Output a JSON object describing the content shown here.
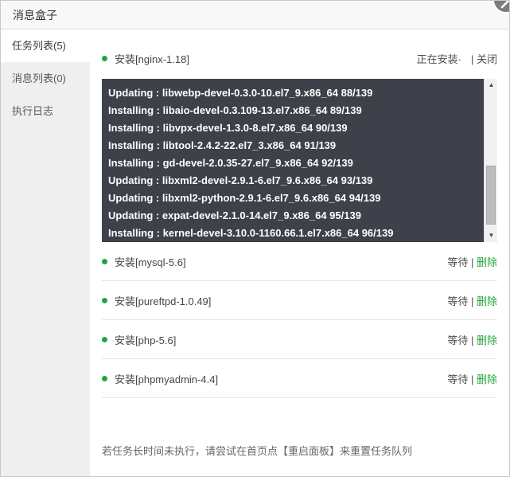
{
  "window": {
    "title": "消息盒子"
  },
  "sidebar": {
    "items": [
      {
        "label": "任务列表(5)"
      },
      {
        "label": "消息列表(0)"
      },
      {
        "label": "执行日志"
      }
    ]
  },
  "ui": {
    "pipe": "|"
  },
  "tasks": {
    "installing": {
      "name": "安装[nginx-1.18]",
      "status": "正在安装·",
      "close_label": "关闭"
    },
    "waiting": [
      {
        "name": "安装[mysql-5.6]",
        "status": "等待",
        "delete_label": "删除"
      },
      {
        "name": "安装[pureftpd-1.0.49]",
        "status": "等待",
        "delete_label": "删除"
      },
      {
        "name": "安装[php-5.6]",
        "status": "等待",
        "delete_label": "删除"
      },
      {
        "name": "安装[phpmyadmin-4.4]",
        "status": "等待",
        "delete_label": "删除"
      }
    ]
  },
  "console": {
    "lines": [
      "Updating : libwebp-devel-0.3.0-10.el7_9.x86_64 88/139",
      "Installing : libaio-devel-0.3.109-13.el7.x86_64 89/139",
      "Installing : libvpx-devel-1.3.0-8.el7.x86_64 90/139",
      "Installing : libtool-2.4.2-22.el7_3.x86_64 91/139",
      "Installing : gd-devel-2.0.35-27.el7_9.x86_64 92/139",
      "Updating : libxml2-devel-2.9.1-6.el7_9.6.x86_64 93/139",
      "Updating : libxml2-python-2.9.1-6.el7_9.6.x86_64 94/139",
      "Updating : expat-devel-2.1.0-14.el7_9.x86_64 95/139",
      "Installing : kernel-devel-3.10.0-1160.66.1.el7.x86_64 96/139"
    ],
    "scroll_up_glyph": "▲",
    "scroll_down_glyph": "▼"
  },
  "footer": {
    "hint": "若任务长时间未执行，请尝试在首页点【重启面板】来重置任务队列"
  },
  "colors": {
    "accent_green": "#20a53a",
    "console_bg": "#3e404a"
  }
}
